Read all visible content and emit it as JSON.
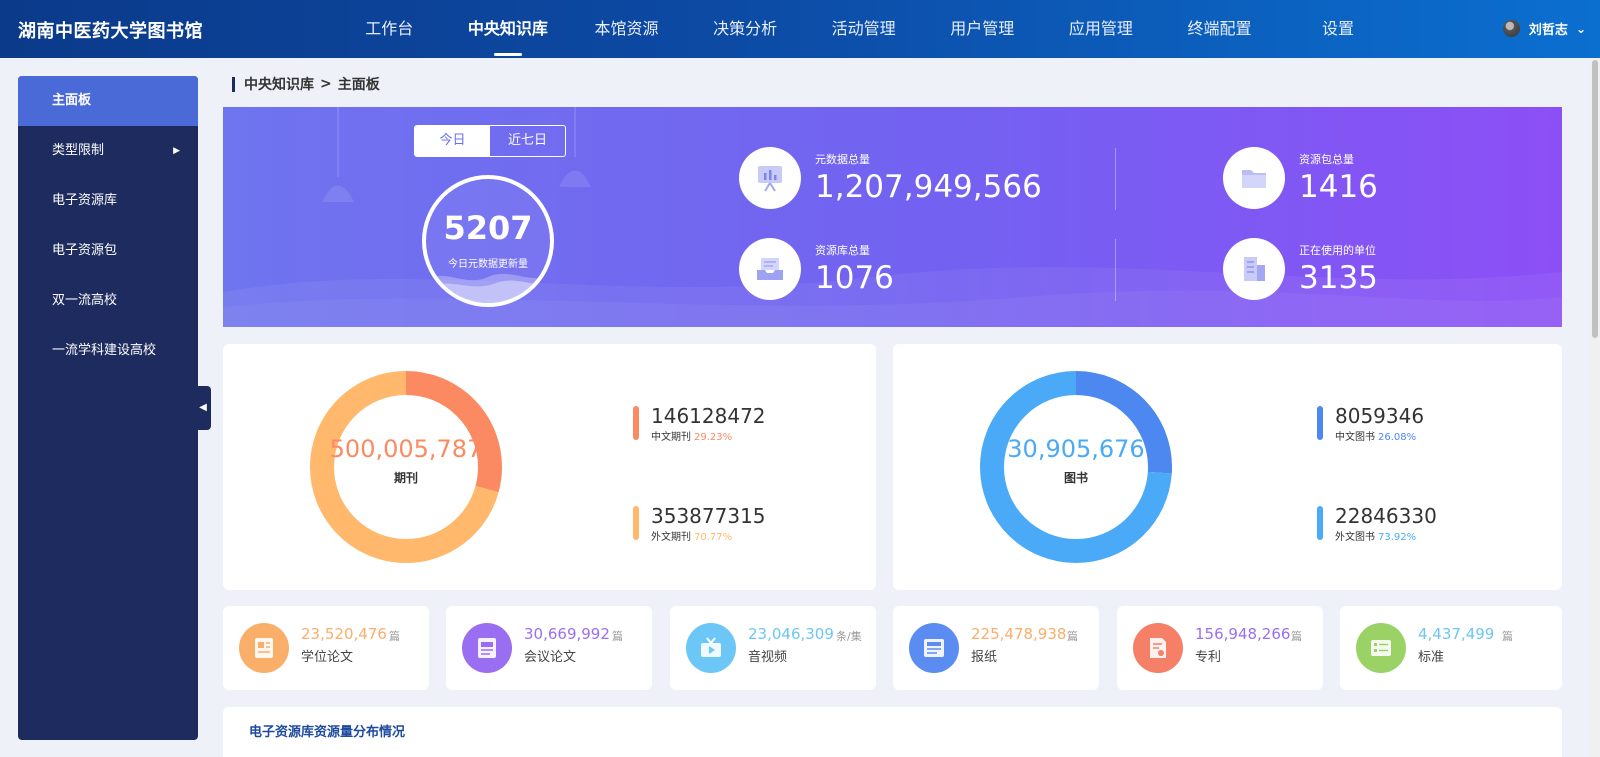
{
  "app": {
    "logo": "湖南中医药大学图书馆",
    "nav": [
      "工作台",
      "中央知识库",
      "本馆资源",
      "决策分析",
      "活动管理",
      "用户管理",
      "应用管理",
      "终端配置",
      "设置"
    ],
    "user": "刘哲志"
  },
  "sidebar": {
    "items": [
      {
        "label": "主面板"
      },
      {
        "label": "类型限制"
      },
      {
        "label": "电子资源库"
      },
      {
        "label": "电子资源包"
      },
      {
        "label": "双一流高校"
      },
      {
        "label": "一流学科建设高校"
      }
    ]
  },
  "breadcrumb": {
    "parent": "中央知识库",
    "sep": ">",
    "current": "主面板"
  },
  "banner": {
    "toggle": [
      "今日",
      "近七日"
    ],
    "today_count": "5207",
    "today_label": "今日元数据更新量",
    "stats": [
      {
        "label": "元数据总量",
        "value": "1,207,949,566"
      },
      {
        "label": "资源包总量",
        "value": "1416"
      },
      {
        "label": "资源库总量",
        "value": "1076"
      },
      {
        "label": "正在使用的单位",
        "value": "3135"
      }
    ]
  },
  "journal": {
    "total": "500,005,787",
    "label": "期刊",
    "items": [
      {
        "value": "146128472",
        "label": "中文期刊",
        "pct": "29.23%",
        "fraction": 0.2923,
        "color": "#fb8a62"
      },
      {
        "value": "353877315",
        "label": "外文期刊",
        "pct": "70.77%",
        "fraction": 0.7077,
        "color": "#ffb86c"
      }
    ]
  },
  "books": {
    "total": "30,905,676",
    "label": "图书",
    "items": [
      {
        "value": "8059346",
        "label": "中文图书",
        "pct": "26.08%",
        "fraction": 0.2608,
        "color": "#4d87f0"
      },
      {
        "value": "22846330",
        "label": "外文图书",
        "pct": "73.92%",
        "fraction": 0.7392,
        "color": "#4aaaf8"
      }
    ]
  },
  "minis": [
    {
      "value": "23,520,476",
      "unit": "篇",
      "label": "学位论文",
      "color": "#f9ae6a",
      "icon": "thesis-icon"
    },
    {
      "value": "30,669,992",
      "unit": "篇",
      "label": "会议论文",
      "color": "#9a6ef0",
      "icon": "conference-icon"
    },
    {
      "value": "23,046,309",
      "unit": "条/集",
      "label": "音视频",
      "color": "#6cc6f6",
      "icon": "video-icon"
    },
    {
      "value": "225,478,938",
      "unit": "篇",
      "label": "报纸",
      "color": "#5a8cf2",
      "icon": "newspaper-icon"
    },
    {
      "value": "156,948,266",
      "unit": "篇",
      "label": "专利",
      "color": "#f67f68",
      "icon": "patent-icon"
    },
    {
      "value": "4,437,499",
      "unit": "篇",
      "label": "标准",
      "color": "#9ad266",
      "icon": "standard-icon"
    }
  ],
  "bottom": {
    "title": "电子资源库资源量分布情况"
  }
}
